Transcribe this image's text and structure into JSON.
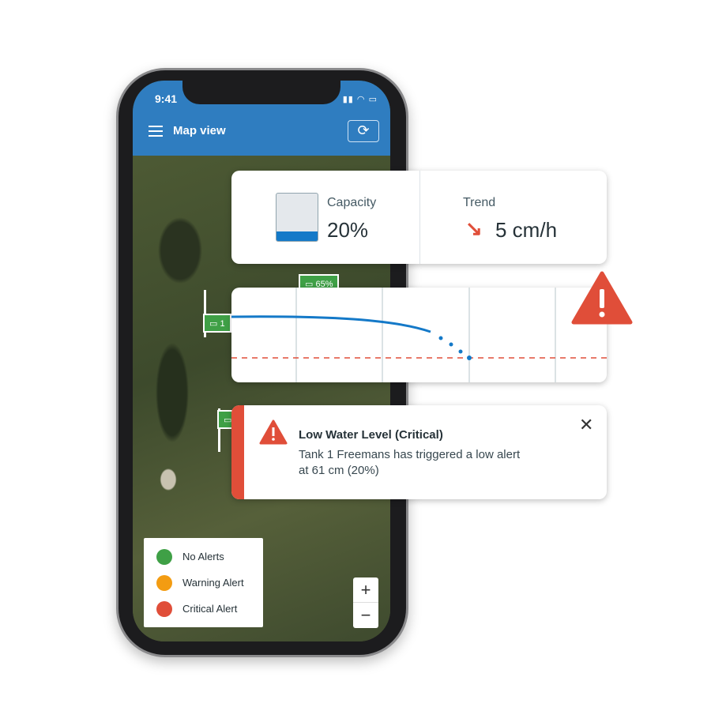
{
  "status_bar": {
    "time": "9:41",
    "icons": "signal wifi battery"
  },
  "header": {
    "title": "Map view",
    "menu_icon": "hamburger-icon",
    "refresh_icon": "refresh-icon"
  },
  "map": {
    "markers": [
      {
        "label": "65%",
        "status": "No Alerts"
      },
      {
        "label": "1",
        "status": "No Alerts"
      },
      {
        "label": "",
        "status": "No Alerts"
      }
    ]
  },
  "legend": {
    "items": [
      {
        "label": "No Alerts",
        "color": "#3fa046"
      },
      {
        "label": "Warning Alert",
        "color": "#f39c12"
      },
      {
        "label": "Critical Alert",
        "color": "#e04e39"
      }
    ]
  },
  "zoom": {
    "in": "+",
    "out": "−"
  },
  "capacity": {
    "label": "Capacity",
    "value": "20%",
    "fill_percent": 20
  },
  "trend": {
    "label": "Trend",
    "value": "5 cm/h",
    "direction": "down-right",
    "color": "#e04e39"
  },
  "alert": {
    "title": "Low Water Level (Critical)",
    "message_line1": "Tank 1 Freemans has triggered a low alert",
    "message_line2": "at 61 cm (20%)",
    "color": "#e04e39"
  }
}
